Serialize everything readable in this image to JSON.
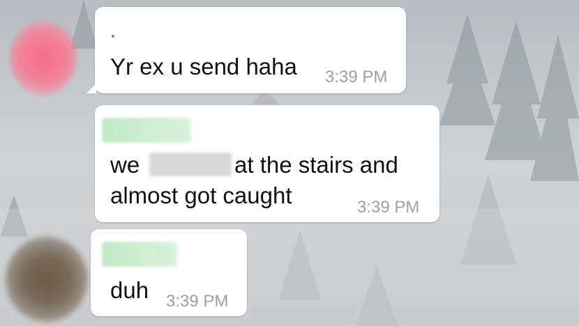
{
  "messages": [
    {
      "text": "Yr ex u send haha",
      "time": "3:39 PM"
    },
    {
      "line1_before": "we",
      "line1_after": "at the stairs and",
      "line2": "almost got caught",
      "time": "3:39 PM"
    },
    {
      "text": "duh",
      "time": "3:39 PM"
    }
  ],
  "colors": {
    "bubble": "#ffffff",
    "timestamp": "#9aa0a6",
    "text": "#111111",
    "redacted_name": "#c8ecca"
  }
}
